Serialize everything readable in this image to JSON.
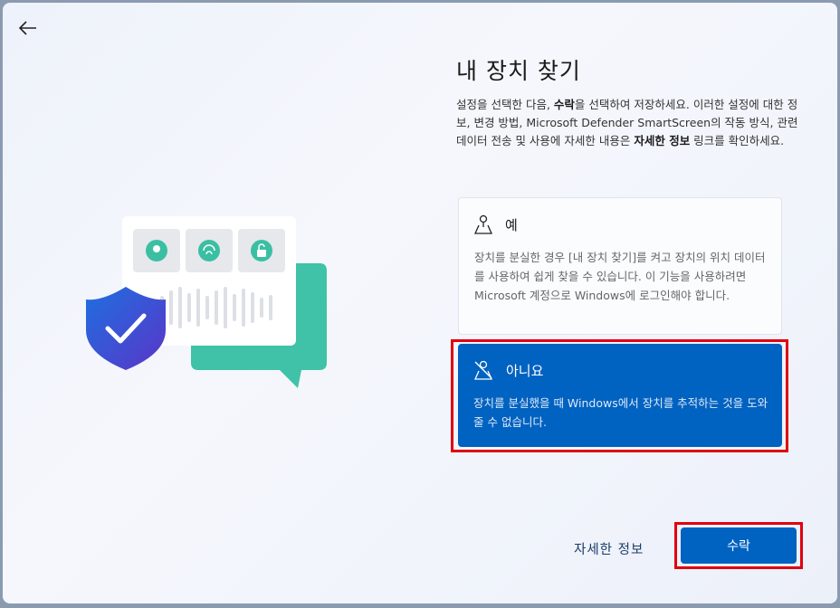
{
  "header": {
    "title": "내 장치 찾기",
    "back_icon": "back-arrow-icon"
  },
  "description": {
    "part1": "설정을 선택한 다음, ",
    "bold1": "수락",
    "part2": "을 선택하여 저장하세요. 이러한 설정에 대한 정보, 변경 방법, Microsoft Defender SmartScreen의 작동 방식, 관련 데이터 전송 및 사용에 자세한 내용은 ",
    "bold2": "자세한 정보",
    "part3": " 링크를 확인하세요."
  },
  "options": [
    {
      "label": "예",
      "icon": "location-on-icon",
      "selected": false,
      "description": "장치를 분실한 경우 [내 장치 찾기]를 켜고 장치의 위치 데이터를 사용하여 쉽게 찾을 수 있습니다. 이 기능을 사용하려면 Microsoft 계정으로 Windows에 로그인해야 합니다."
    },
    {
      "label": "아니요",
      "icon": "location-off-icon",
      "selected": true,
      "description": "장치를 분실했을 때 Windows에서 장치를 추적하는 것을 도와줄 수 없습니다."
    }
  ],
  "footer": {
    "learn_more": "자세한 정보",
    "accept": "수락"
  },
  "colors": {
    "accent": "#0062c1",
    "highlight": "#e00010"
  }
}
